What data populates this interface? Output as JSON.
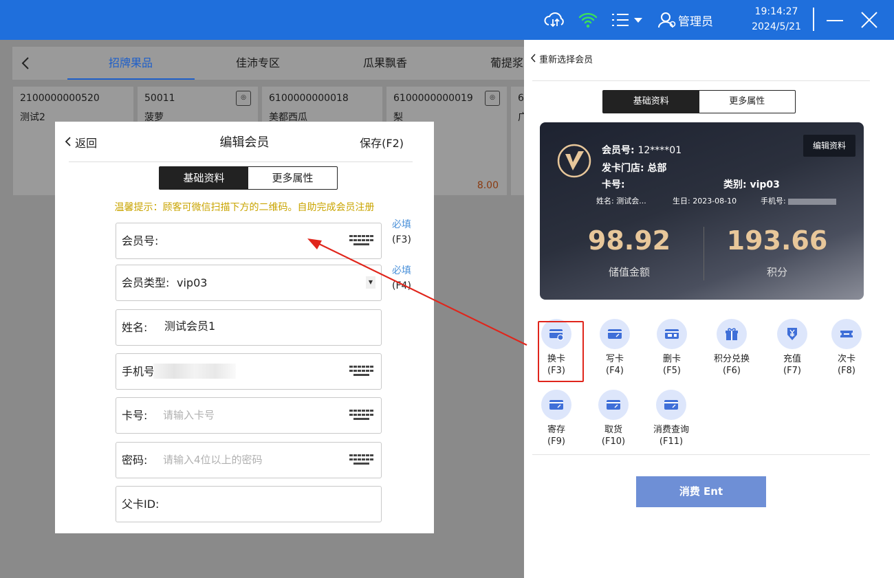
{
  "topbar": {
    "user": "管理员",
    "time": "19:14:27",
    "date": "2024/5/21"
  },
  "categories": [
    "招牌果品",
    "佳沛专区",
    "瓜果飘香",
    "葡提浆"
  ],
  "products": [
    {
      "code": "2100000000520",
      "name": "测试2"
    },
    {
      "code": "50011",
      "name": "菠萝"
    },
    {
      "code": "6100000000018",
      "name": "美都西瓜"
    },
    {
      "code": "6100000000019",
      "name": "梨",
      "price": "8.00"
    },
    {
      "code": "6",
      "name": "广"
    }
  ],
  "modal": {
    "back": "返回",
    "title": "编辑会员",
    "save": "保存(F2)",
    "tabs": [
      "基础资料",
      "更多属性"
    ],
    "tip": "温馨提示：顾客可微信扫描下方的二维码。自助完成会员注册",
    "fields": {
      "member_no": {
        "label": "会员号:",
        "value": ""
      },
      "member_type": {
        "label": "会员类型:",
        "value": "vip03"
      },
      "name": {
        "label": "姓名:",
        "value": "测试会员1"
      },
      "phone": {
        "label": "手机号",
        "value": ""
      },
      "card_no": {
        "label": "卡号:",
        "placeholder": "请输入卡号"
      },
      "password": {
        "label": "密码:",
        "placeholder": "请输入4位以上的密码"
      },
      "parent_card": {
        "label": "父卡ID:",
        "value": ""
      }
    },
    "required": [
      {
        "text": "必填",
        "key": "(F3)"
      },
      {
        "text": "必填",
        "key": "(F4)"
      }
    ]
  },
  "panel": {
    "back": "重新选择会员",
    "tabs": [
      "基础资料",
      "更多属性"
    ],
    "card": {
      "edit": "编辑资料",
      "member_no_label": "会员号:",
      "member_no": "12****01",
      "store_label": "发卡门店:",
      "store": "总部",
      "card_label": "卡号:",
      "category_label": "类别:",
      "category": "vip03",
      "name_label": "姓名:",
      "name": "测试会...",
      "birthday_label": "生日:",
      "birthday": "2023-08-10",
      "phone_label": "手机号:",
      "balance": "98.92",
      "balance_label": "储值金额",
      "points": "193.66",
      "points_label": "积分"
    },
    "actions": [
      {
        "label": "换卡",
        "key": "(F3)",
        "icon": "card-swap-icon"
      },
      {
        "label": "写卡",
        "key": "(F4)",
        "icon": "card-write-icon"
      },
      {
        "label": "删卡",
        "key": "(F5)",
        "icon": "card-delete-icon"
      },
      {
        "label": "积分兑换",
        "key": "(F6)",
        "icon": "gift-icon"
      },
      {
        "label": "充值",
        "key": "(F7)",
        "icon": "recharge-icon"
      },
      {
        "label": "次卡",
        "key": "(F8)",
        "icon": "ticket-icon"
      },
      {
        "label": "寄存",
        "key": "(F9)",
        "icon": "card-icon"
      },
      {
        "label": "取货",
        "key": "(F10)",
        "icon": "card-icon"
      },
      {
        "label": "消费查询",
        "key": "(F11)",
        "icon": "card-icon"
      }
    ],
    "pay": "消费 Ent"
  },
  "colors": {
    "brand": "#1f6fdc",
    "highlight": "#e0251b",
    "tip": "#c9a400",
    "required": "#4a90d9",
    "gold": "#e8c79a"
  }
}
